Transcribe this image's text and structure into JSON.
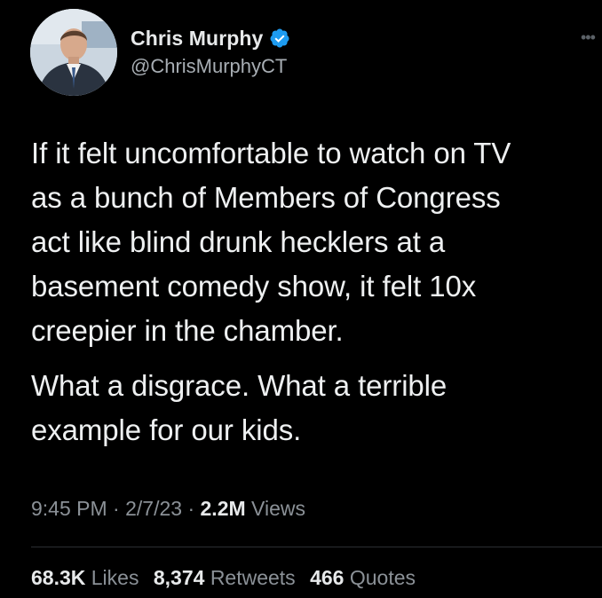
{
  "tweet": {
    "author": {
      "display_name": "Chris Murphy",
      "handle": "@ChrisMurphyCT",
      "verified": true,
      "verified_icon": "verified-badge-icon",
      "avatar_icon": "profile-photo"
    },
    "more_icon": "more-options-icon",
    "paragraphs": [
      "If it felt uncomfortable to watch on TV",
      "as a bunch of Members of Congress",
      "act like blind drunk hecklers at a",
      "basement comedy show, it felt 10x",
      "creepier in the chamber.",
      "What a disgrace. What a terrible",
      "example for our kids."
    ],
    "meta": {
      "time": "9:45 PM",
      "date": "2/7/23",
      "separator": "·",
      "views_count": "2.2M",
      "views_label": "Views"
    },
    "stats": {
      "likes_count": "68.3K",
      "likes_label": "Likes",
      "retweets_count": "8,374",
      "retweets_label": "Retweets",
      "quotes_count": "466",
      "quotes_label": "Quotes"
    }
  },
  "colors": {
    "background": "#000000",
    "primary_text": "#e7e9ea",
    "secondary_text": "#8b9197",
    "verified_blue": "#1d9bf0",
    "divider": "#2b2f33"
  }
}
